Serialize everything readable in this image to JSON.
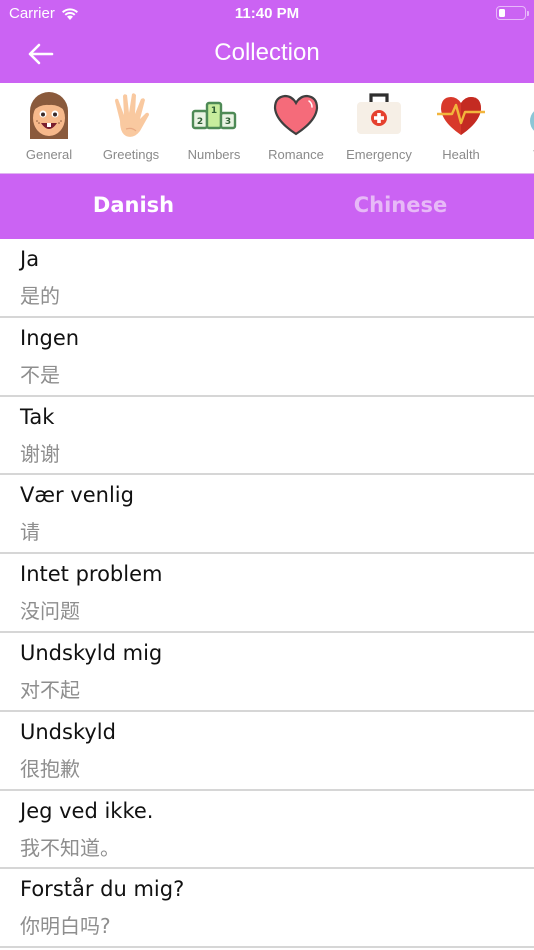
{
  "status_bar": {
    "carrier": "Carrier",
    "time": "11:40 PM",
    "battery_level": 0.25
  },
  "header": {
    "title": "Collection",
    "back_icon": "arrow-left-icon"
  },
  "categories": [
    {
      "label": "General",
      "icon": "girl-face-icon"
    },
    {
      "label": "Greetings",
      "icon": "waving-hand-icon"
    },
    {
      "label": "Numbers",
      "icon": "podium-icon"
    },
    {
      "label": "Romance",
      "icon": "heart-icon"
    },
    {
      "label": "Emergency",
      "icon": "first-aid-kit-icon"
    },
    {
      "label": "Health",
      "icon": "heartbeat-icon"
    },
    {
      "label": "We",
      "icon": "weather-icon"
    }
  ],
  "language_tabs": {
    "source": "Danish",
    "target": "Chinese"
  },
  "phrases": [
    {
      "danish": "Ja",
      "chinese": "是的"
    },
    {
      "danish": "Ingen",
      "chinese": "不是"
    },
    {
      "danish": "Tak",
      "chinese": "谢谢"
    },
    {
      "danish": "Vær venlig",
      "chinese": "请"
    },
    {
      "danish": "Intet problem",
      "chinese": "没问题"
    },
    {
      "danish": "Undskyld mig",
      "chinese": "对不起"
    },
    {
      "danish": "Undskyld",
      "chinese": "很抱歉"
    },
    {
      "danish": "Jeg ved ikke.",
      "chinese": "我不知道。"
    },
    {
      "danish": "Forstår du mig?",
      "chinese": "你明白吗?"
    }
  ],
  "colors": {
    "accent": "#cb63f3",
    "inactive_tab_text": "#e7b9f7",
    "secondary_text": "#8e8e8e"
  }
}
